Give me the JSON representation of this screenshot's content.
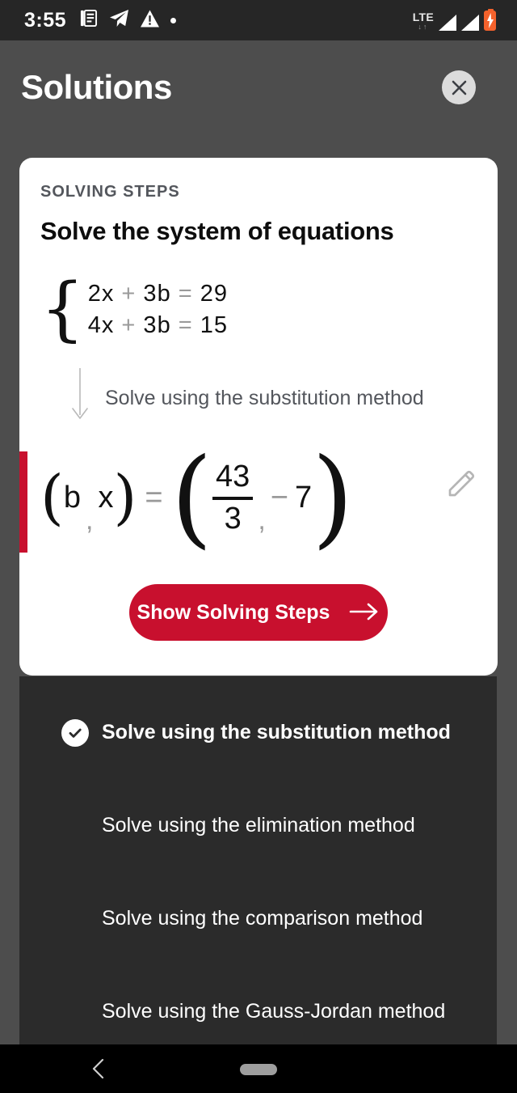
{
  "statusbar": {
    "time": "3:55",
    "icons": [
      "notes-icon",
      "telegram-icon",
      "warning-icon",
      "dot-icon"
    ],
    "network": "LTE",
    "data_arrows": "↓↑",
    "signal_bars": 2,
    "battery_state": "charging"
  },
  "header": {
    "title": "Solutions",
    "close_label": "×"
  },
  "card": {
    "label": "SOLVING STEPS",
    "title": "Solve the system of equations",
    "equations": [
      {
        "lhs_a": "2",
        "var_a": "x",
        "plus": "+",
        "lhs_b": "3",
        "var_b": "b",
        "eq": "=",
        "rhs": "29"
      },
      {
        "lhs_a": "4",
        "var_a": "x",
        "plus": "+",
        "lhs_b": "3",
        "var_b": "b",
        "eq": "=",
        "rhs": "15"
      }
    ],
    "method_note": "Solve using the substitution method",
    "answer": {
      "lhs_open": "(",
      "var1": "b",
      "comma1": ",",
      "var2": "x",
      "lhs_close": ")",
      "equals": "=",
      "rhs_open": "(",
      "numerator": "43",
      "denominator": "3",
      "comma2": ",",
      "minus": "−",
      "value2": "7",
      "rhs_close": ")"
    },
    "cta_label": "Show Solving Steps",
    "edit_icon": "pencil-icon"
  },
  "methods": [
    {
      "label": "Solve using the substitution method",
      "selected": true
    },
    {
      "label": "Solve using the elimination method",
      "selected": false
    },
    {
      "label": "Solve using the comparison method",
      "selected": false
    },
    {
      "label": "Solve using the Gauss-Jordan method",
      "selected": false
    }
  ],
  "navbar": {
    "back_icon": "back-chevron-icon",
    "home_icon": "home-handle-icon"
  },
  "colors": {
    "accent": "#c8102e",
    "background": "#4d4d4d",
    "panel": "#2b2b2b",
    "card": "#ffffff",
    "statusbar": "#262626",
    "battery": "#f4622c"
  }
}
